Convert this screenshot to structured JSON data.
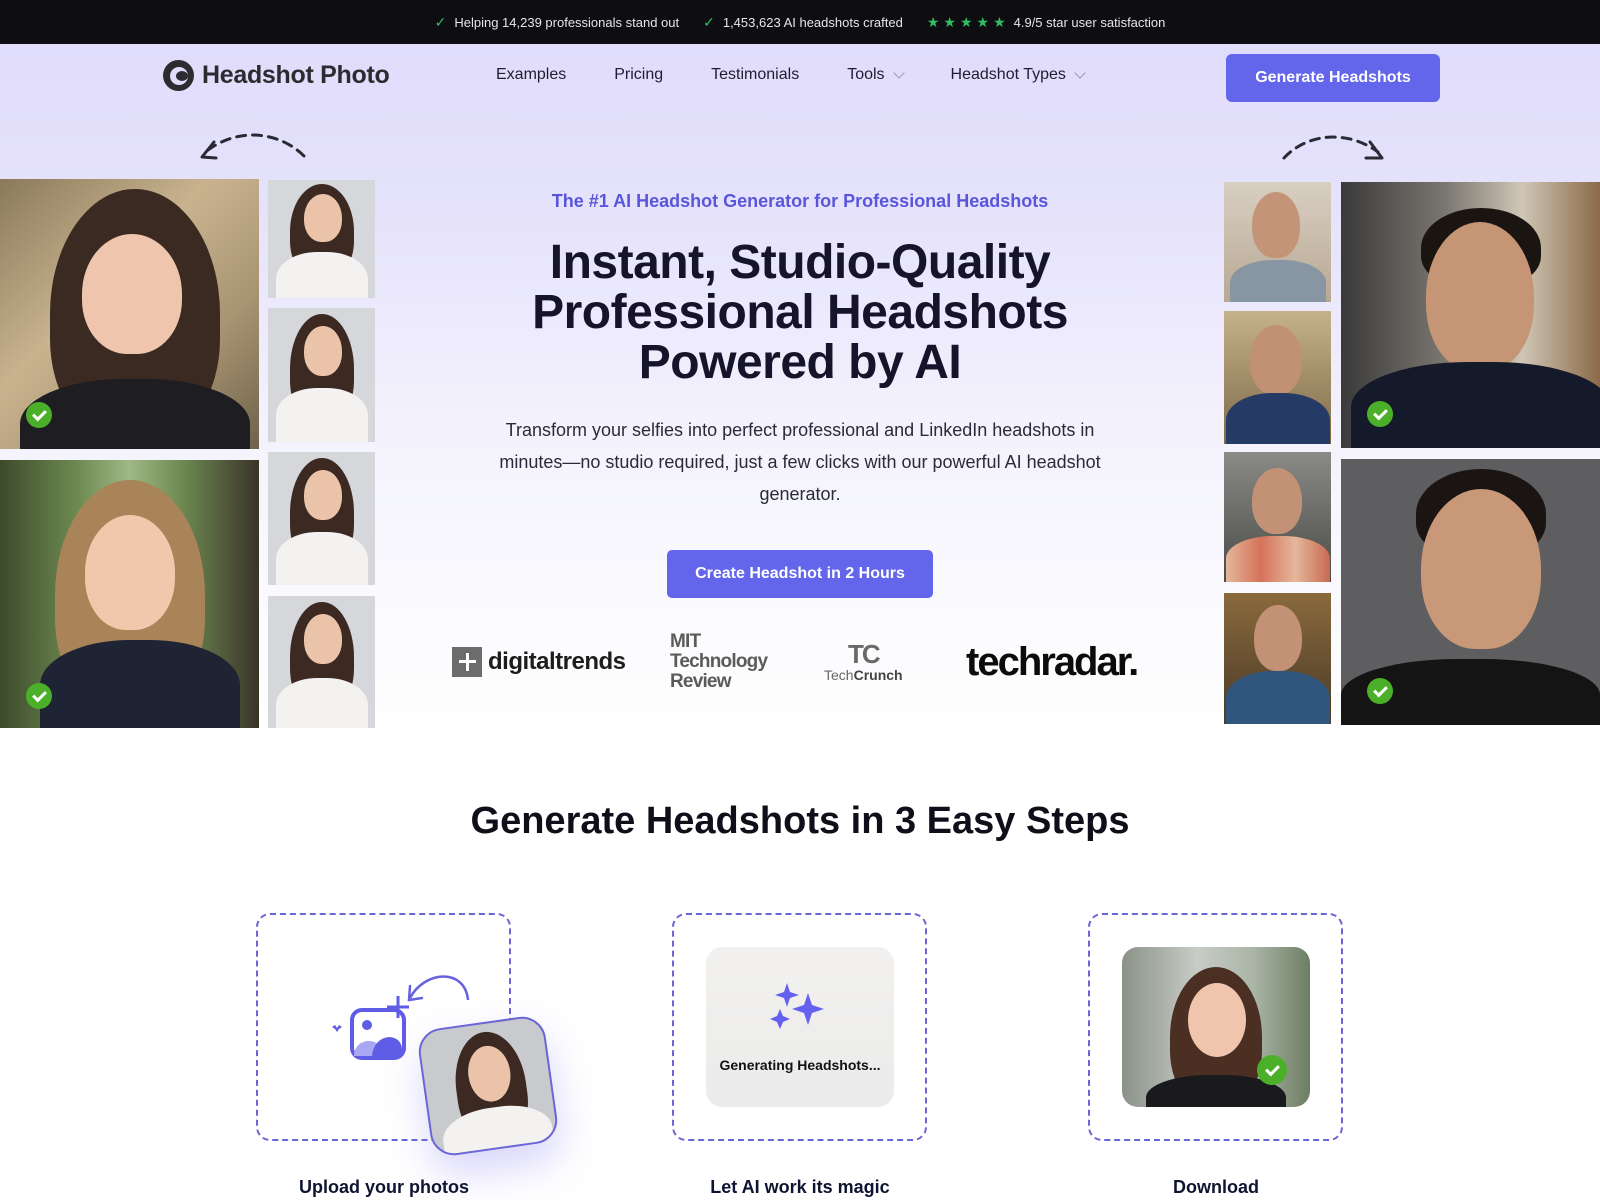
{
  "topbar": {
    "items": [
      {
        "icon": "check-icon",
        "text": "Helping 14,239 professionals stand out"
      },
      {
        "icon": "check-icon",
        "text": "1,453,623 AI headshots crafted"
      },
      {
        "icon": "star-icon",
        "stars": 5,
        "text": "4.9/5 star user satisfaction"
      }
    ]
  },
  "nav": {
    "logo_text": "Headshot Photo",
    "links": [
      {
        "label": "Examples",
        "dropdown": false
      },
      {
        "label": "Pricing",
        "dropdown": false
      },
      {
        "label": "Testimonials",
        "dropdown": false
      },
      {
        "label": "Tools",
        "dropdown": true
      },
      {
        "label": "Headshot Types",
        "dropdown": true
      }
    ],
    "cta_label": "Generate Headshots"
  },
  "hero": {
    "eyebrow": "The #1 AI Headshot Generator for Professional Headshots",
    "title": "Instant, Studio-Quality Professional Headshots Powered by AI",
    "subtitle": "Transform your selfies into perfect professional and LinkedIn headshots in minutes—no studio required, just a few clicks with our powerful AI headshot generator.",
    "cta_label": "Create Headshot in 2 Hours",
    "press": {
      "digitaltrends": "digitaltrends",
      "mit_line1": "MIT",
      "mit_line2": "Technology",
      "mit_line3": "Review",
      "techcrunch_mark": "TC",
      "techcrunch_a": "Tech",
      "techcrunch_b": "Crunch",
      "techradar": "techradar."
    }
  },
  "steps": {
    "title": "Generate Headshots in 3 Easy Steps",
    "items": [
      {
        "label": "Upload your photos"
      },
      {
        "label": "Let AI work its magic",
        "status": "Generating Headshots..."
      },
      {
        "label": "Download"
      }
    ]
  },
  "colors": {
    "accent": "#6366ea",
    "eyebrow": "#5a56db",
    "success": "#4caf2a",
    "topbar_bg": "#0e0e12",
    "hero_bg": "#e0dcfb"
  }
}
